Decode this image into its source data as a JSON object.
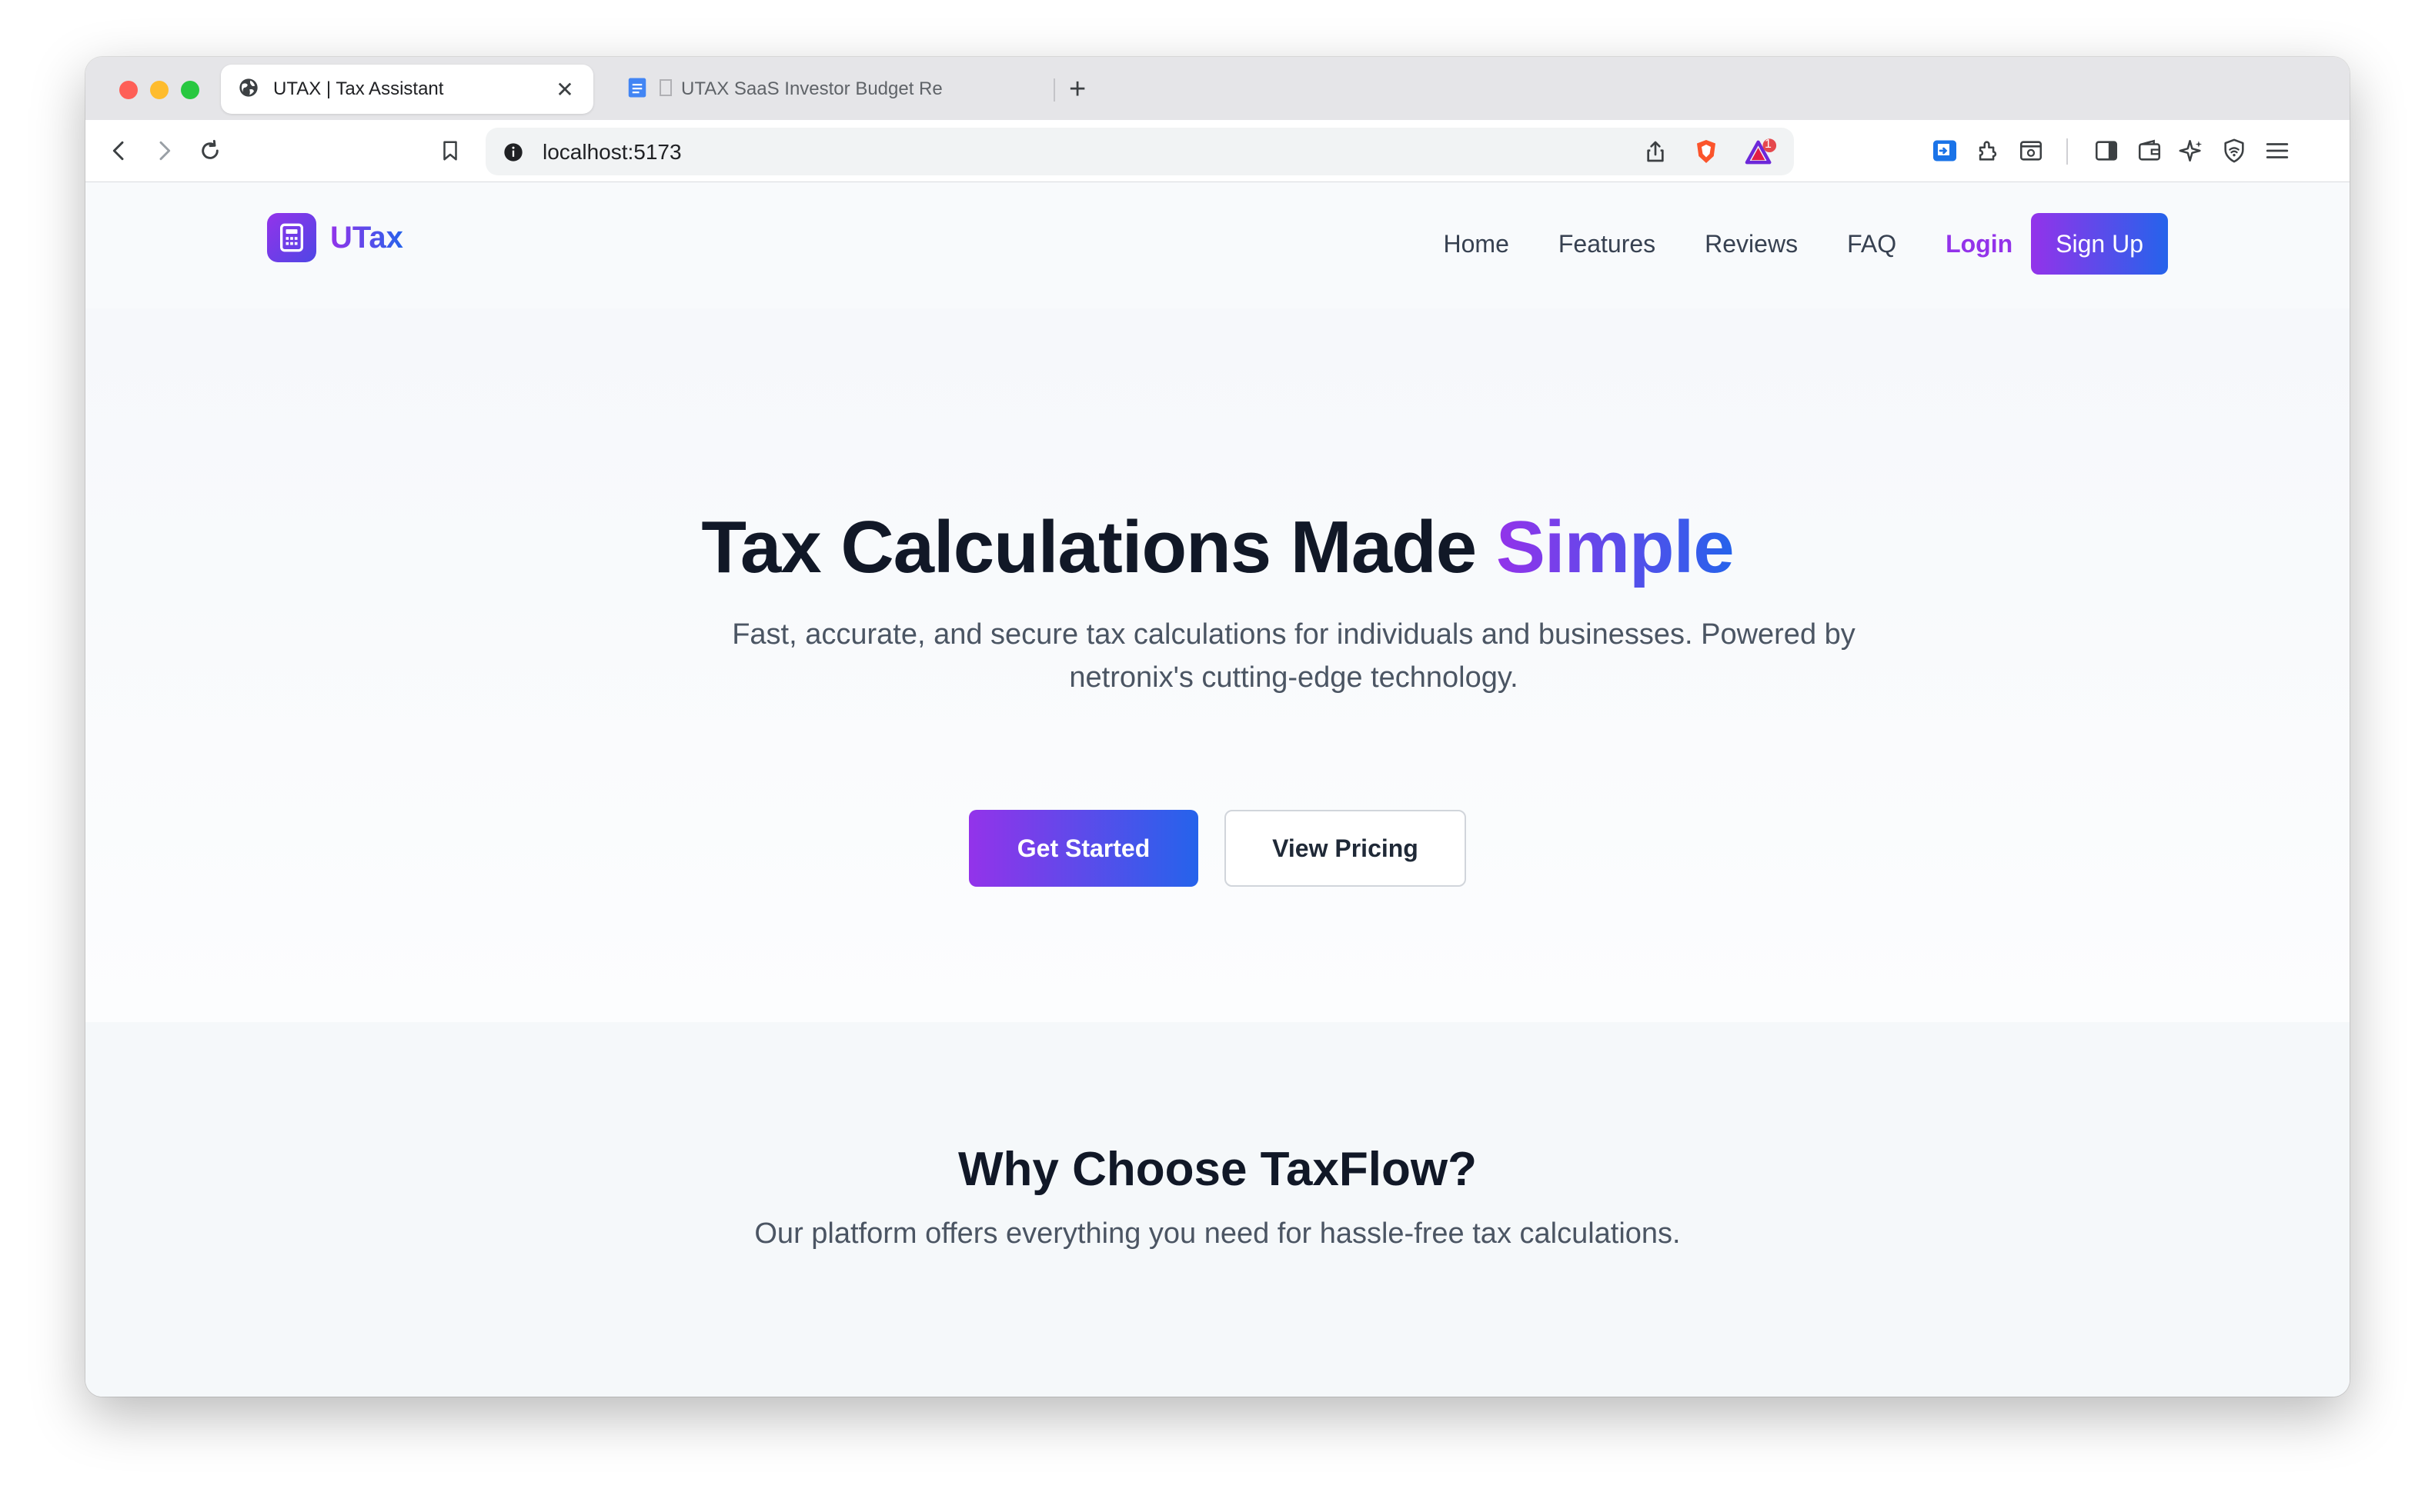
{
  "browser": {
    "tabs": [
      {
        "title": "UTAX | Tax Assistant",
        "active": true,
        "icon": "globe-icon"
      },
      {
        "title": "UTAX SaaS Investor Budget Re",
        "active": false,
        "icon": "docs-icon"
      }
    ],
    "new_tab_label": "+",
    "close_label": "✕",
    "url": "localhost:5173",
    "notification_count": "1"
  },
  "site": {
    "brand": "UTax",
    "nav": {
      "home": "Home",
      "features": "Features",
      "reviews": "Reviews",
      "faq": "FAQ",
      "login": "Login",
      "signup": "Sign Up"
    },
    "hero": {
      "title_main": "Tax Calculations Made ",
      "title_accent": "Simple",
      "subtitle": "Fast, accurate, and secure tax calculations for individuals and businesses. Powered by netronix's cutting-edge technology.",
      "primary_button": "Get Started",
      "secondary_button": "View Pricing"
    },
    "why": {
      "title": "Why Choose TaxFlow?",
      "subtitle": "Our platform offers everything you need for hassle-free tax calculations."
    }
  },
  "colors": {
    "brand_purple": "#9333ea",
    "brand_blue": "#2563eb",
    "text_dark": "#111827",
    "text_muted": "#4b5563"
  }
}
